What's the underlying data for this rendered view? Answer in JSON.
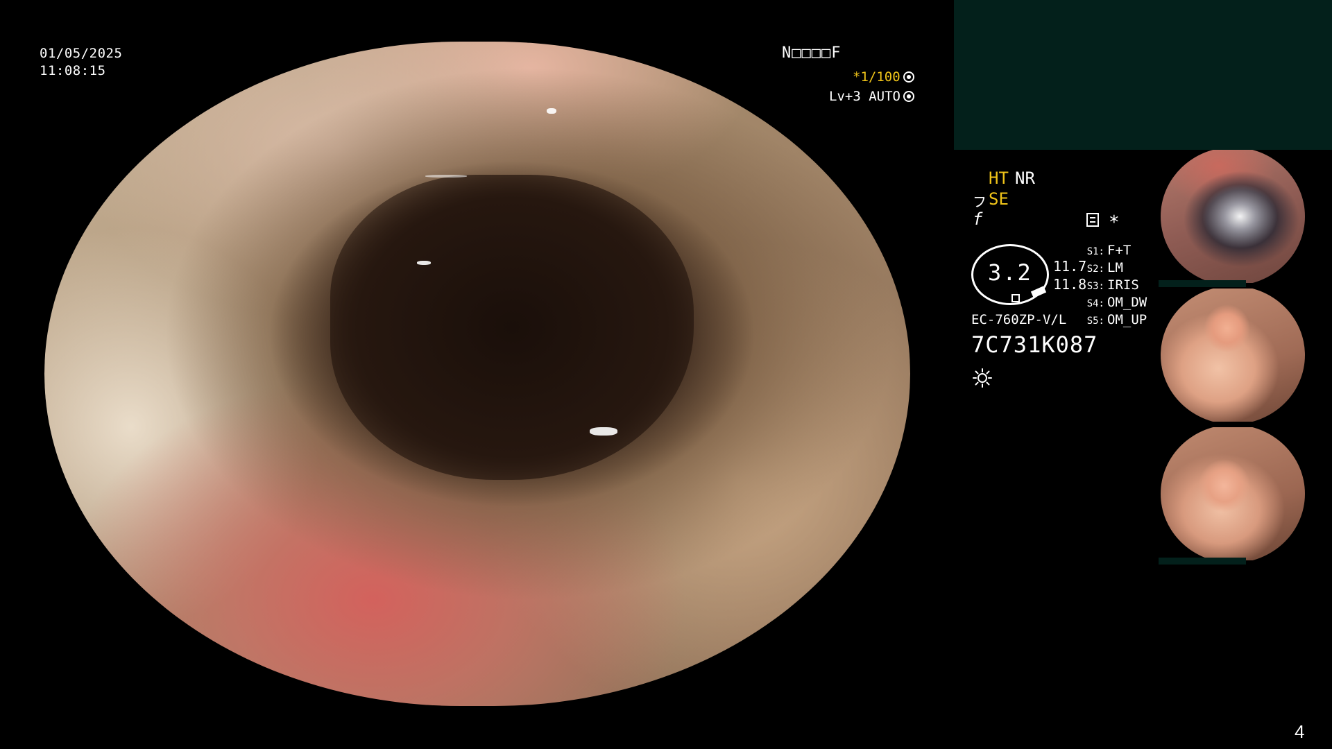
{
  "overlay": {
    "date": "01/05/2025",
    "time": "11:08:15",
    "mode": "N□□□□F",
    "zoom_prefix": "*1/100",
    "level": "Lv+3 AUTO"
  },
  "panel": {
    "ht": "HT",
    "nr": "NR",
    "se": "SE",
    "se_icon": "フ",
    "f_icon": "f",
    "asterisk": "*",
    "gauge_value": "3.2",
    "value_upper": "11.7",
    "value_lower": "11.8",
    "switches": [
      {
        "key": "S1:",
        "value": "F+T"
      },
      {
        "key": "S2:",
        "value": "LM"
      },
      {
        "key": "S3:",
        "value": "IRIS"
      },
      {
        "key": "S4:",
        "value": "OM_DW"
      },
      {
        "key": "S5:",
        "value": "OM_UP"
      }
    ],
    "scope_model": "EC-760ZP-V/L",
    "serial_number": "7C731K087"
  },
  "colors": {
    "yellow_text": "#f0c419",
    "panel_bg": "#03201b"
  },
  "page_number": "4"
}
